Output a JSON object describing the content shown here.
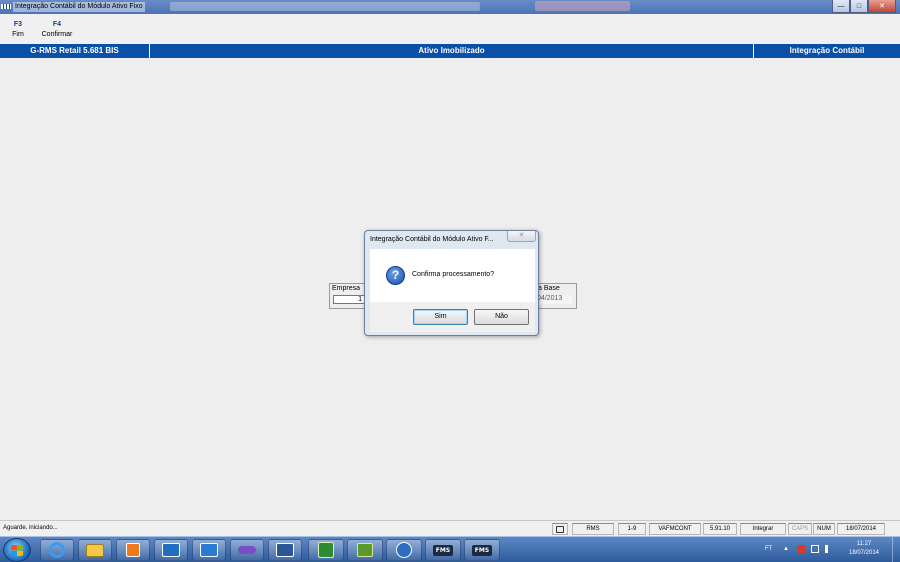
{
  "window": {
    "title": "Integração Contábil do Módulo Ativo Fixo",
    "controls": {
      "minimize": "—",
      "maximize": "□",
      "close": "✕"
    }
  },
  "toolbar": {
    "items": [
      {
        "key": "F3",
        "label": "Fim"
      },
      {
        "key": "F4",
        "label": "Confirmar"
      }
    ]
  },
  "header": {
    "system": "G-RMS Retail 5.681 BIS",
    "module": "Ativo Imobilizado",
    "function": "Integração Contábil"
  },
  "form": {
    "empresa_label": "Empresa",
    "empresa_value": "1",
    "data_base_label": "a Base",
    "data_base_value": "/04/2013"
  },
  "dialog": {
    "title": "Integração Contábil do Módulo Ativo F...",
    "close": "✕",
    "icon": "question-icon",
    "icon_glyph": "?",
    "message": "Confirma processamento?",
    "yes_label": "Sim",
    "no_label": "Não"
  },
  "statusbar": {
    "message": "Aguarde, iniciando...",
    "cells": [
      "RMS",
      "1-9",
      "VAFMCONT",
      "5.91.10",
      "Integrar",
      "CAPS",
      "NUM",
      "18/07/2014"
    ]
  },
  "taskbar": {
    "apps": [
      "internet-explorer",
      "file-explorer",
      "media-player",
      "outlook",
      "lync",
      "app",
      "word",
      "app-plus",
      "app-green",
      "app-globe",
      "FMS",
      "FMS"
    ],
    "tray": {
      "lang": "FT",
      "arrow": "▲",
      "time": "11:27",
      "date": "18/07/2014"
    }
  },
  "colors": {
    "header_bg": "#0a4fa8",
    "title_bg": "#4a74b8",
    "taskbar_bg": "#2e5b9b"
  }
}
